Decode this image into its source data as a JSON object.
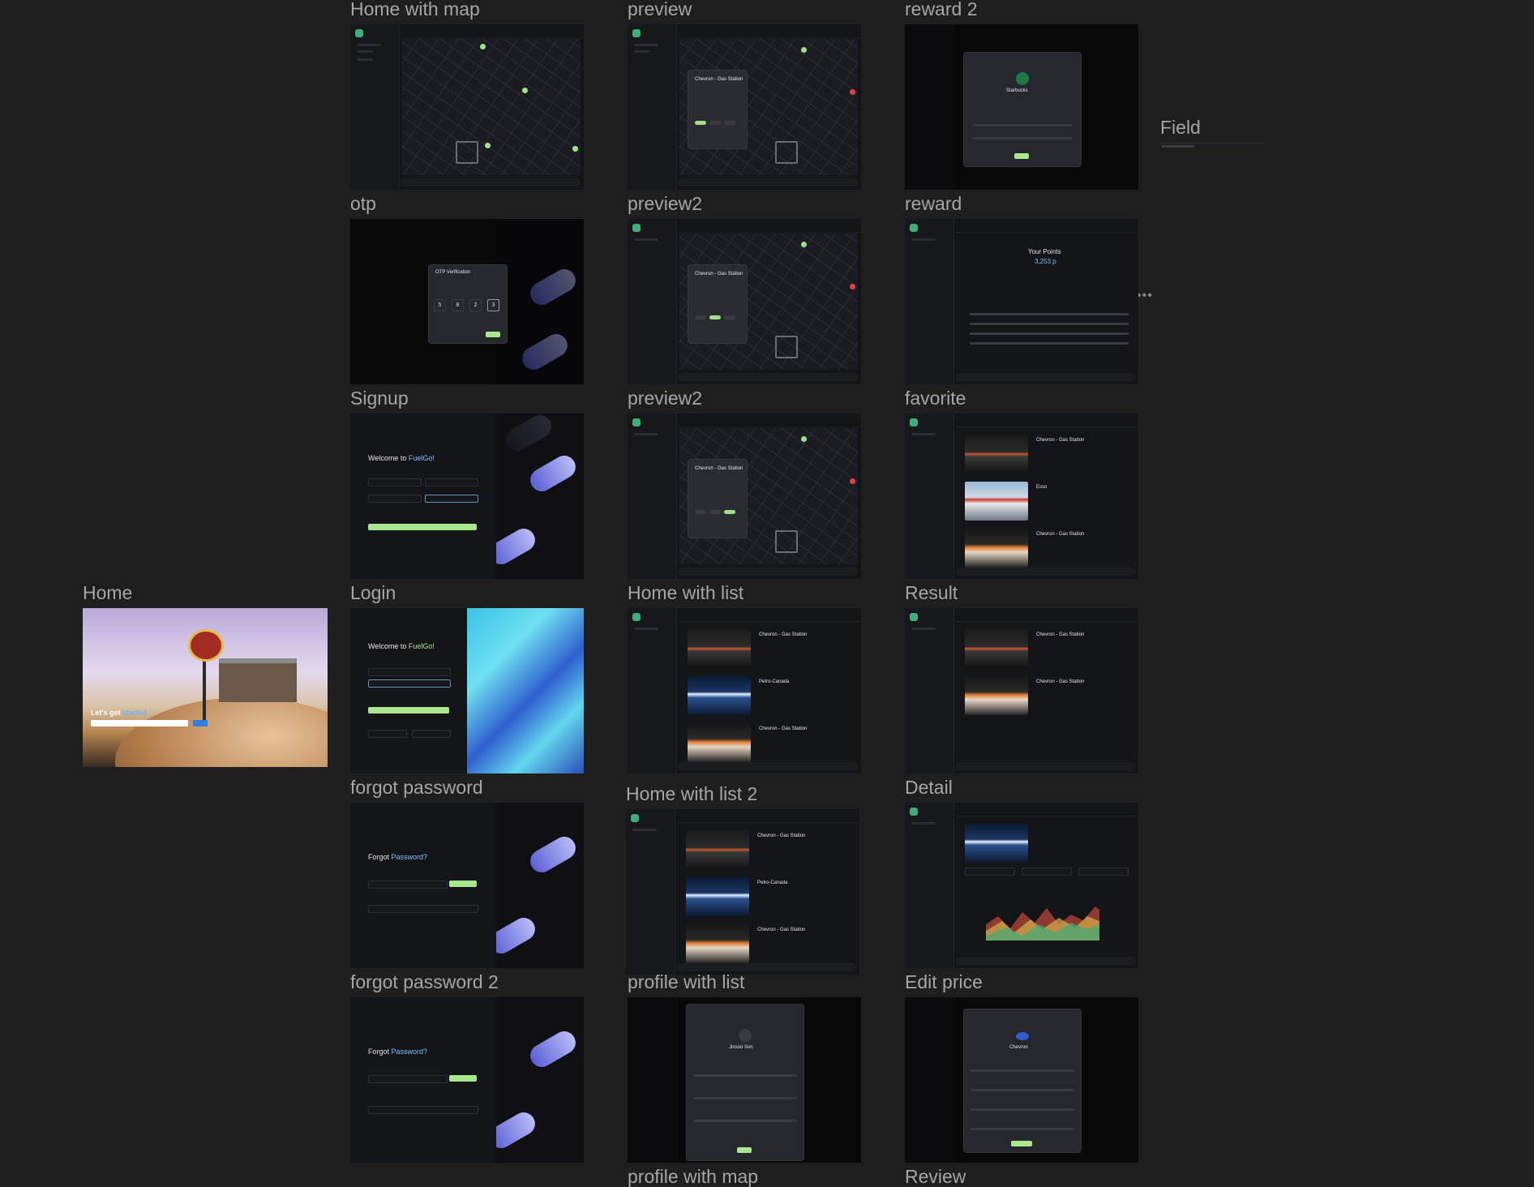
{
  "labels": {
    "home_with_map": "Home with map",
    "preview": "preview",
    "reward2": "reward 2",
    "field": "Field",
    "otp": "otp",
    "preview2_a": "preview2",
    "reward": "reward",
    "signup": "Signup",
    "preview2_b": "preview2",
    "favorite": "favorite",
    "home": "Home",
    "login": "Login",
    "home_with_list": "Home with list",
    "result": "Result",
    "forgot_password": "forgot password",
    "home_with_list_2": "Home with list 2",
    "detail": "Detail",
    "forgot_password_2": "forgot password 2",
    "profile_with_list": "profile with list",
    "edit_price": "Edit price",
    "profile_with_map": "profile with map",
    "review": "Review"
  },
  "text": {
    "station_chevron": "Chevron - Gas Station",
    "station_petro": "Petro-Canada",
    "station_esso": "Esso",
    "reward_title": "Your Points",
    "reward_points": "3,253 p",
    "starbucks": "Starbucks",
    "welcome": "Welcome to ",
    "brand": "FuelGo!",
    "forgot": "Forgot ",
    "password": "Password?",
    "otp_title": "OTP Verification",
    "otp_digits": [
      "5",
      "8",
      "2",
      "3"
    ],
    "lets_get": "Let's get ",
    "started": "started",
    "profile_name": "Jinsoo Son",
    "chevron": "Chevron"
  },
  "colors": {
    "canvas": "#1f1f1f",
    "frame": "#141518",
    "accent_green": "#a9e88e",
    "accent_blue": "#7ec1ff",
    "pin_red": "#e0443c"
  }
}
